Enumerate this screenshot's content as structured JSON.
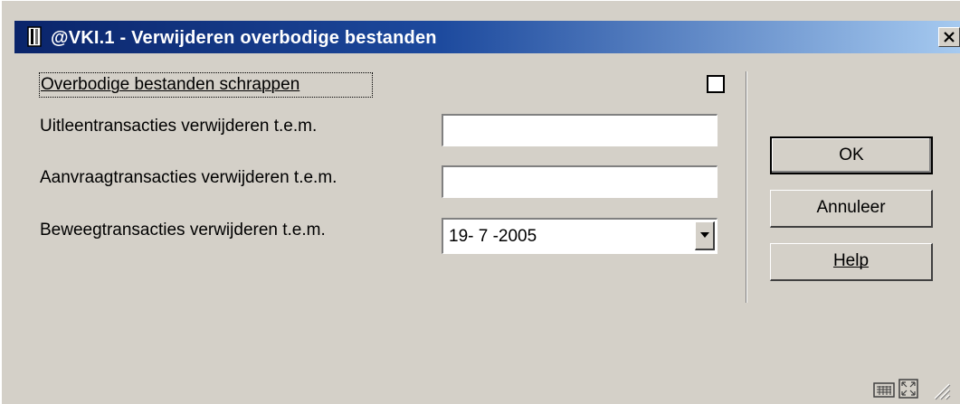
{
  "window": {
    "title": "@VKI.1 - Verwijderen overbodige bestanden"
  },
  "form": {
    "checkbox_label": "Overbodige bestanden schrappen",
    "checkbox_checked": false,
    "uitleen_label": "Uitleentransacties verwijderen t.e.m.",
    "uitleen_value": "",
    "aanvraag_label": "Aanvraagtransacties verwijderen t.e.m.",
    "aanvraag_value": "",
    "beweeg_label": "Beweegtransacties verwijderen t.e.m.",
    "beweeg_value": "19- 7 -2005"
  },
  "buttons": {
    "ok": "OK",
    "cancel": "Annuleer",
    "help": "Help"
  },
  "icons": {
    "title": "book-icon",
    "close": "close-icon",
    "dropdown": "chevron-down-icon",
    "keyboard": "keyboard-icon",
    "resize": "resize-icon",
    "grip": "size-grip-icon"
  }
}
